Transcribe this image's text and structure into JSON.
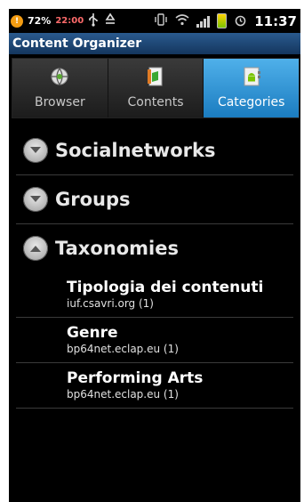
{
  "status_bar": {
    "battery_percent": "72%",
    "small_time": "22:00",
    "clock": "11:37",
    "icons": [
      "alert-icon",
      "usb-icon",
      "recycle-icon",
      "vibrate-icon",
      "wifi-icon",
      "signal-icon",
      "battery-icon",
      "alarm-icon"
    ]
  },
  "app": {
    "title": "Content Organizer"
  },
  "tabs": [
    {
      "label": "Browser",
      "icon": "globe-icon",
      "active": false
    },
    {
      "label": "Contents",
      "icon": "document-icon",
      "active": false
    },
    {
      "label": "Categories",
      "icon": "android-folder-icon",
      "active": true
    }
  ],
  "groups": [
    {
      "label": "Socialnetworks",
      "expanded": false
    },
    {
      "label": "Groups",
      "expanded": false
    },
    {
      "label": "Taxonomies",
      "expanded": true,
      "children": [
        {
          "title": "Tipologia dei contenuti",
          "subtitle": "iuf.csavri.org (1)"
        },
        {
          "title": "Genre",
          "subtitle": "bp64net.eclap.eu (1)"
        },
        {
          "title": "Performing Arts",
          "subtitle": "bp64net.eclap.eu (1)"
        }
      ]
    }
  ],
  "colors": {
    "accent_tab": "#2a8fd6",
    "title_bar": "#1f4a78",
    "background": "#000000"
  }
}
